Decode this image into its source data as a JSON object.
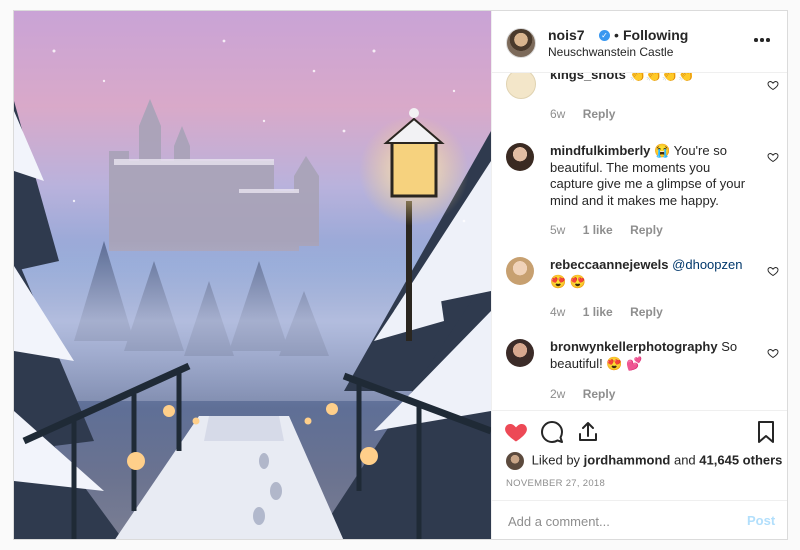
{
  "header": {
    "username": "nois7",
    "separator": "•",
    "follow_status": "Following",
    "location": "Neuschwanstein Castle",
    "verified_icon": "verified-badge-icon",
    "more_icon": "more-options-icon"
  },
  "comments": [
    {
      "username": "kings_shots",
      "text": "👏👏👏👏",
      "age": "6w",
      "likes": "",
      "reply": "Reply"
    },
    {
      "username": "mindfulkimberly",
      "text": "😭  You're so beautiful. The moments you capture give me a glimpse of your mind and it makes me happy.",
      "age": "5w",
      "likes": "1 like",
      "reply": "Reply"
    },
    {
      "username": "rebeccaannejewels",
      "mention": "@dhoopzen",
      "text": "😍 😍",
      "age": "4w",
      "likes": "1 like",
      "reply": "Reply"
    },
    {
      "username": "bronwynkellerphotography",
      "text": "So beautiful! 😍 💕",
      "age": "2w",
      "likes": "",
      "reply": "Reply"
    }
  ],
  "actions": {
    "like_icon": "heart-filled-icon",
    "comment_icon": "comment-icon",
    "share_icon": "share-icon",
    "save_icon": "bookmark-icon"
  },
  "likes": {
    "prefix": "Liked by",
    "user": "jordhammond",
    "conjunction": "and",
    "count": "41,645 others"
  },
  "date": "NOVEMBER 27, 2018",
  "add_comment": {
    "placeholder": "Add a comment...",
    "post_label": "Post"
  },
  "colors": {
    "like_red": "#ed4956",
    "verified_blue": "#3897f0",
    "post_disabled": "#b2dffc",
    "meta_gray": "#8e8e8e"
  }
}
